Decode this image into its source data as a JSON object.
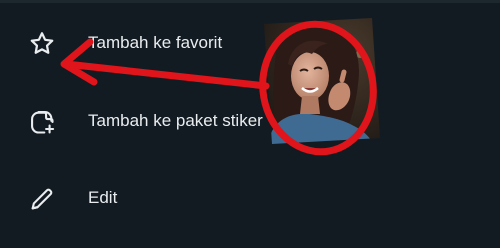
{
  "menu": {
    "items": [
      {
        "label": "Tambah ke favorit",
        "icon": "star-outline-icon"
      },
      {
        "label": "Tambah ke paket stiker",
        "icon": "sticker-add-icon"
      },
      {
        "label": "Edit",
        "icon": "pencil-icon"
      }
    ]
  },
  "sticker": {
    "subject": "sticker-photo"
  },
  "annotation": {
    "color": "#e0141b"
  },
  "colors": {
    "background": "#121b22",
    "text": "#e9edef",
    "icon": "#e9edef"
  }
}
